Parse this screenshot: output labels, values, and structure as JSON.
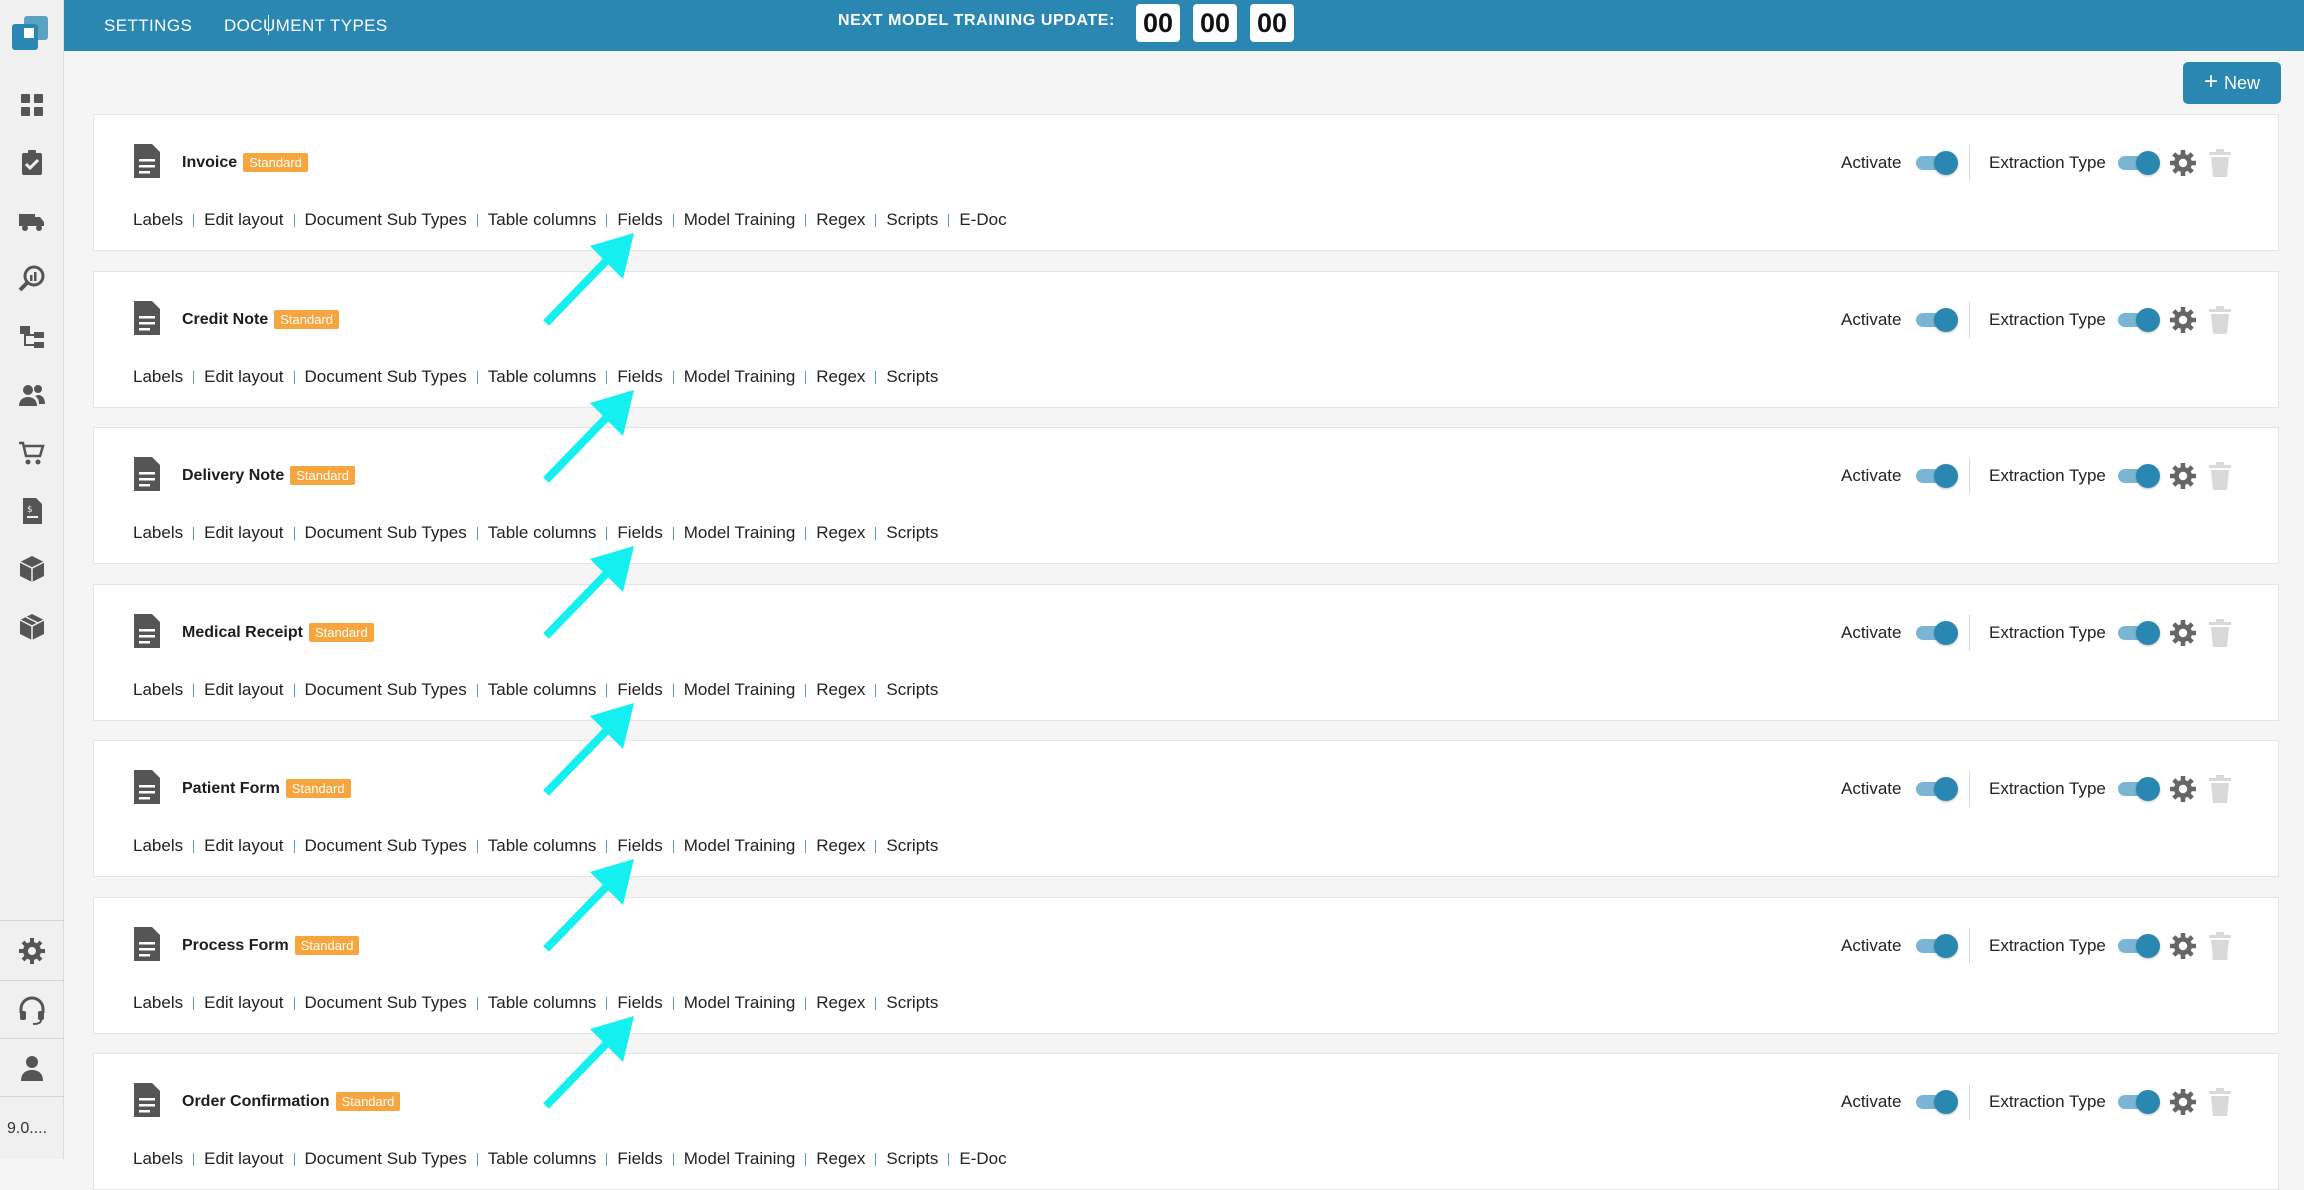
{
  "header": {
    "breadcrumb": [
      "SETTINGS",
      "DOCUMENT TYPES"
    ],
    "timer_label": "NEXT MODEL TRAINING UPDATE:",
    "timer": [
      "00",
      "00",
      "00"
    ]
  },
  "sidebar": {
    "items": [
      {
        "icon": "dashboard-icon"
      },
      {
        "icon": "task-check-icon"
      },
      {
        "icon": "truck-icon"
      },
      {
        "icon": "analytics-search-icon"
      },
      {
        "icon": "workflow-icon"
      },
      {
        "icon": "users-icon"
      },
      {
        "icon": "cart-icon"
      },
      {
        "icon": "invoice-icon"
      },
      {
        "icon": "box-icon"
      },
      {
        "icon": "box-outline-icon"
      }
    ],
    "bottom": [
      {
        "icon": "settings-gear-icon"
      },
      {
        "icon": "headset-icon"
      },
      {
        "icon": "user-icon"
      }
    ],
    "version": "9.0...."
  },
  "toolbar": {
    "new_label": "New"
  },
  "labels": {
    "activate": "Activate",
    "extraction_type": "Extraction Type"
  },
  "colors": {
    "primary": "#2a87b1",
    "badge": "#f7a53e",
    "arrow": "#14f0f0"
  },
  "document_types": [
    {
      "name": "Invoice",
      "badge": "Standard",
      "activate": true,
      "extraction": true,
      "links": [
        "Labels",
        "Edit layout",
        "Document Sub Types",
        "Table columns",
        "Fields",
        "Model Training",
        "Regex",
        "Scripts",
        "E-Doc"
      ]
    },
    {
      "name": "Credit Note",
      "badge": "Standard",
      "activate": true,
      "extraction": true,
      "links": [
        "Labels",
        "Edit layout",
        "Document Sub Types",
        "Table columns",
        "Fields",
        "Model Training",
        "Regex",
        "Scripts"
      ]
    },
    {
      "name": "Delivery Note",
      "badge": "Standard",
      "activate": true,
      "extraction": true,
      "links": [
        "Labels",
        "Edit layout",
        "Document Sub Types",
        "Table columns",
        "Fields",
        "Model Training",
        "Regex",
        "Scripts"
      ]
    },
    {
      "name": "Medical Receipt",
      "badge": "Standard",
      "activate": true,
      "extraction": true,
      "links": [
        "Labels",
        "Edit layout",
        "Document Sub Types",
        "Table columns",
        "Fields",
        "Model Training",
        "Regex",
        "Scripts"
      ]
    },
    {
      "name": "Patient Form",
      "badge": "Standard",
      "activate": true,
      "extraction": true,
      "links": [
        "Labels",
        "Edit layout",
        "Document Sub Types",
        "Table columns",
        "Fields",
        "Model Training",
        "Regex",
        "Scripts"
      ]
    },
    {
      "name": "Process Form",
      "badge": "Standard",
      "activate": true,
      "extraction": true,
      "links": [
        "Labels",
        "Edit layout",
        "Document Sub Types",
        "Table columns",
        "Fields",
        "Model Training",
        "Regex",
        "Scripts"
      ]
    },
    {
      "name": "Order Confirmation",
      "badge": "Standard",
      "activate": true,
      "extraction": true,
      "links": [
        "Labels",
        "Edit layout",
        "Document Sub Types",
        "Table columns",
        "Fields",
        "Model Training",
        "Regex",
        "Scripts",
        "E-Doc"
      ]
    }
  ]
}
